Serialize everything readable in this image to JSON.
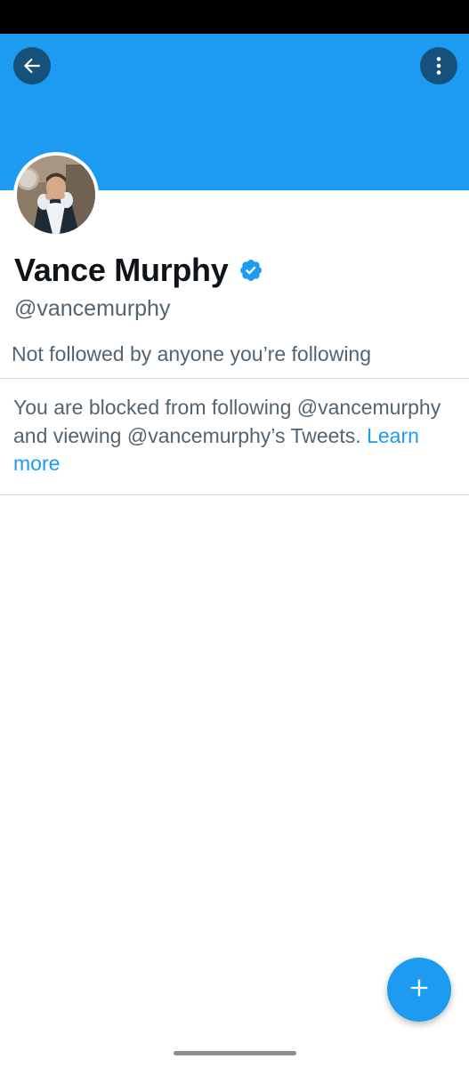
{
  "profile": {
    "display_name": "Vance Murphy",
    "handle": "@vancemurphy",
    "verified": true,
    "followers_note": "Not followed by anyone you’re following"
  },
  "blocked": {
    "message": "You are blocked from following @vancemurphy and viewing @vancemurphy’s Tweets.",
    "link_label": "Learn more"
  },
  "icons": {
    "back": "arrow-left-icon",
    "more": "more-vertical-icon",
    "verified": "verified-badge-icon",
    "compose": "plus-icon"
  },
  "colors": {
    "banner": "#1d9bf0",
    "accent": "#1d9bf0",
    "secondary_text": "#536471",
    "primary_text": "#0f1419"
  }
}
